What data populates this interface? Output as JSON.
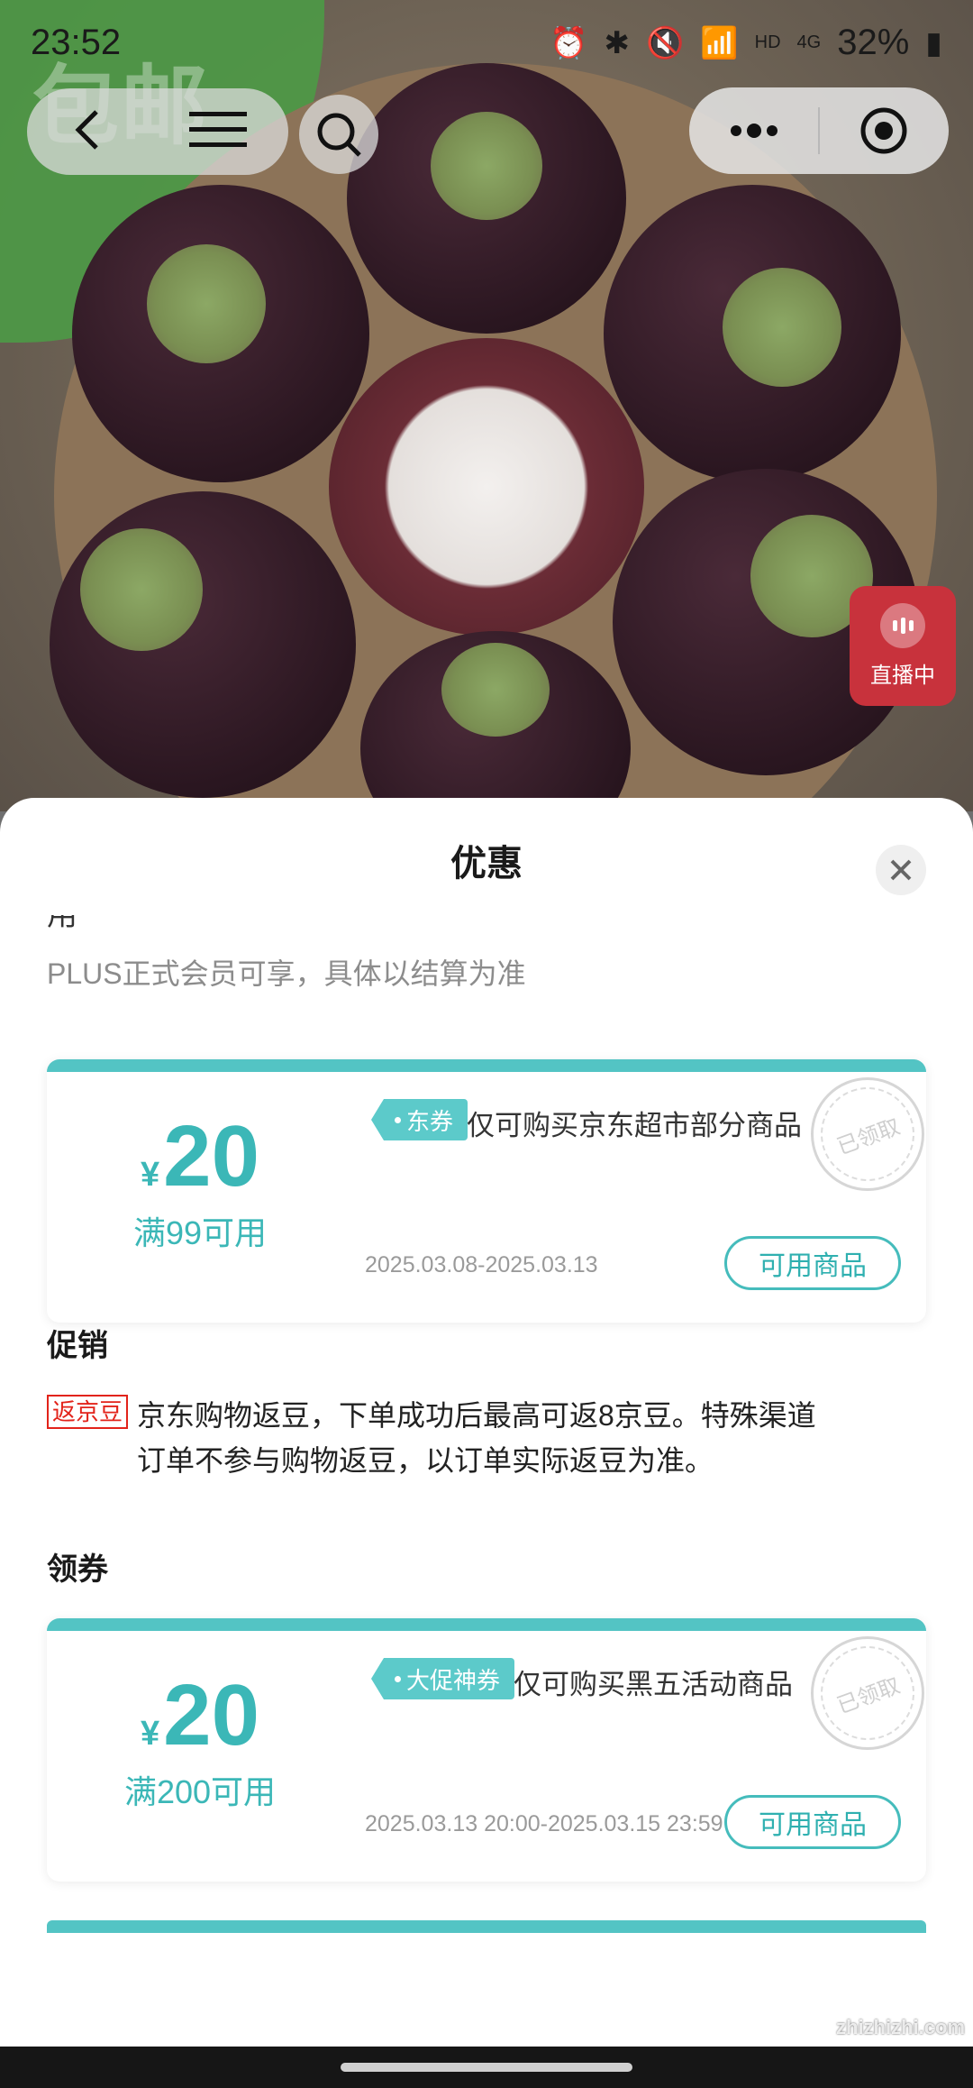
{
  "status_bar": {
    "time": "23:52",
    "battery": "32%",
    "network": "4G",
    "hd": "HD"
  },
  "hero": {
    "watermark": "包邮",
    "live_label": "直播中"
  },
  "sheet": {
    "title": "优惠",
    "cut_text": "用",
    "plus_note": "PLUS正式会员可享，具体以结算为准",
    "coupons": [
      {
        "currency": "¥",
        "amount": "20",
        "condition": "满99可用",
        "tag": "东券",
        "description": "仅可购买京东超市部分商品",
        "date": "2025.03.08-2025.03.13",
        "button": "可用商品",
        "stamp": "已领取"
      },
      {
        "currency": "¥",
        "amount": "20",
        "condition": "满200可用",
        "tag": "大促神券",
        "description": "仅可购买黑五活动商品",
        "date": "2025.03.13 20:00-2025.03.15 23:59",
        "button": "可用商品",
        "stamp": "已领取"
      }
    ],
    "promo_section": "促销",
    "promo_badge": "返京豆",
    "promo_text_line1": "京东购物返豆，下单成功后最高可返8京豆。特殊渠道",
    "promo_text_line2": "订单不参与购物返豆，以订单实际返豆为准。",
    "coupon_section": "领券"
  },
  "watermark_site": "zhizhizhi.com",
  "colors": {
    "teal": "#53c4c4",
    "teal_text": "#3bb7b7",
    "red_badge": "#e2231a",
    "live_red": "#c8323c"
  }
}
